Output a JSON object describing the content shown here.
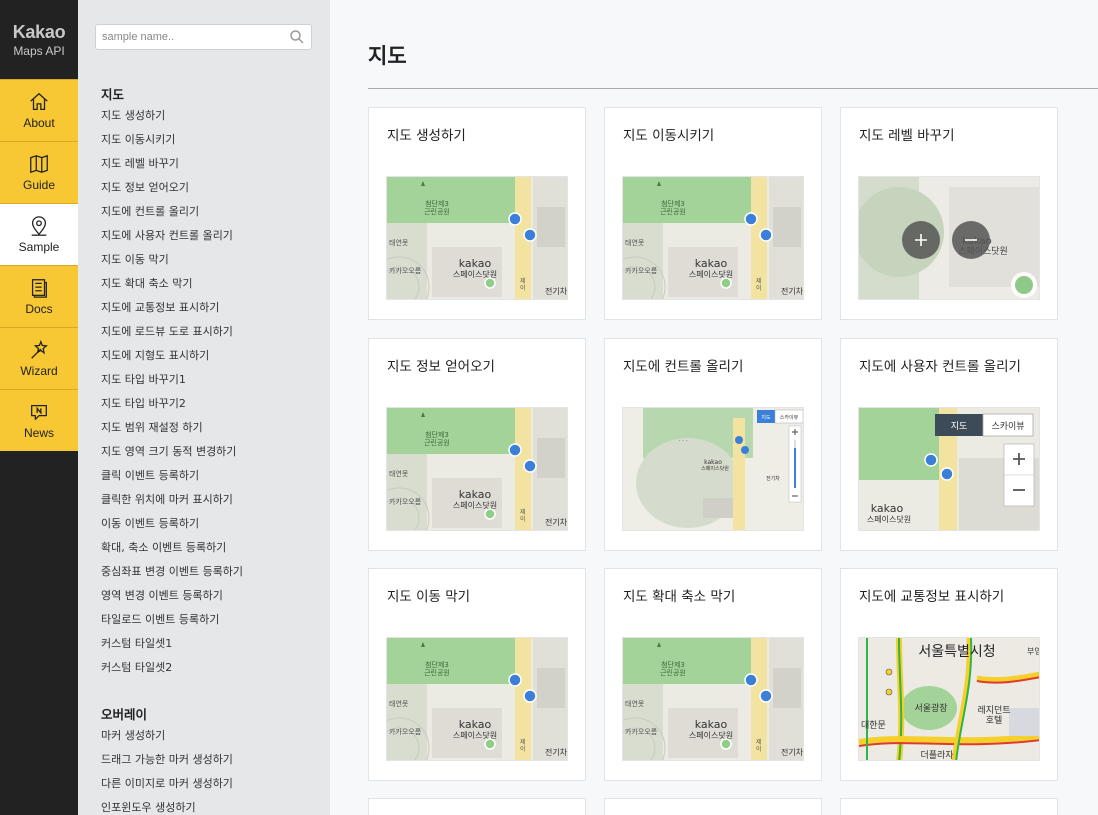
{
  "brand": {
    "line1": "Kakao",
    "line2": "Maps API"
  },
  "nav": [
    {
      "label": "About",
      "icon": "home-icon"
    },
    {
      "label": "Guide",
      "icon": "map-book-icon"
    },
    {
      "label": "Sample",
      "icon": "location-pin-icon",
      "active": true
    },
    {
      "label": "Docs",
      "icon": "document-icon"
    },
    {
      "label": "Wizard",
      "icon": "magic-wand-icon"
    },
    {
      "label": "News",
      "icon": "news-bubble-icon"
    }
  ],
  "search": {
    "placeholder": "sample name.."
  },
  "sections": [
    {
      "title": "지도",
      "items": [
        "지도 생성하기",
        "지도 이동시키기",
        "지도 레벨 바꾸기",
        "지도 정보 얻어오기",
        "지도에 컨트롤 올리기",
        "지도에 사용자 컨트롤 올리기",
        "지도 이동 막기",
        "지도 확대 축소 막기",
        "지도에 교통정보 표시하기",
        "지도에 로드뷰 도로 표시하기",
        "지도에 지형도 표시하기",
        "지도 타입 바꾸기1",
        "지도 타입 바꾸기2",
        "지도 범위 재설정 하기",
        "지도 영역 크기 동적 변경하기",
        "클릭 이벤트 등록하기",
        "클릭한 위치에 마커 표시하기",
        "이동 이벤트 등록하기",
        "확대, 축소 이벤트 등록하기",
        "중심좌표 변경 이벤트 등록하기",
        "영역 변경 이벤트 등록하기",
        "타일로드 이벤트 등록하기",
        "커스텀 타일셋1",
        "커스텀 타일셋2"
      ]
    },
    {
      "title": "오버레이",
      "items": [
        "마커 생성하기",
        "드래그 가능한 마커 생성하기",
        "다른 이미지로 마커 생성하기",
        "인포윈도우 생성하기"
      ]
    }
  ],
  "main": {
    "title": "지도",
    "cards": [
      {
        "title": "지도 생성하기",
        "thumb": "base"
      },
      {
        "title": "지도 이동시키기",
        "thumb": "base"
      },
      {
        "title": "지도 레벨 바꾸기",
        "thumb": "level"
      },
      {
        "title": "지도 정보 얻어오기",
        "thumb": "base"
      },
      {
        "title": "지도에 컨트롤 올리기",
        "thumb": "control"
      },
      {
        "title": "지도에 사용자 컨트롤 올리기",
        "thumb": "usercontrol"
      },
      {
        "title": "지도 이동 막기",
        "thumb": "base"
      },
      {
        "title": "지도 확대 축소 막기",
        "thumb": "base"
      },
      {
        "title": "지도에 교통정보 표시하기",
        "thumb": "traffic"
      }
    ]
  },
  "map_labels": {
    "park": "첨단제3\n근린공원",
    "kakao": "kakao",
    "spacedot": "스페이스닷원",
    "left1": "태연못",
    "left2": "카카오오름",
    "right1": "제\n이",
    "right2": "전기차",
    "maptype_map": "지도",
    "maptype_sky": "스카이뷰",
    "traffic_city": "서울특별시청",
    "traffic_plaza": "서울광장",
    "traffic_hotel": "레지던트\n호텔",
    "traffic_near": "더플라자",
    "traffic_left": "대한문",
    "traffic_right": "부영"
  },
  "colors": {
    "nav_yellow": "#f7c833",
    "rail_dark": "#222222",
    "park_green": "#8fc98a",
    "road_yellow": "#f5e08a",
    "bus_blue": "#3b7fd9"
  }
}
